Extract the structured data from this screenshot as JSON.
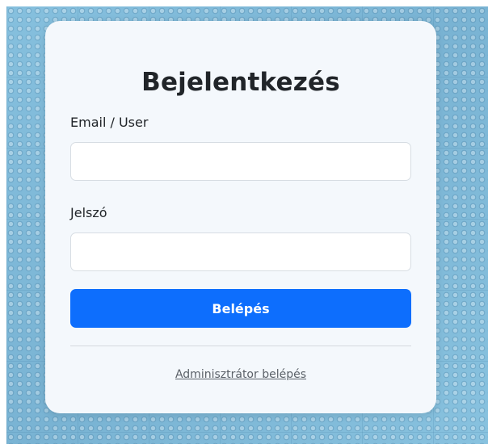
{
  "login": {
    "title": "Bejelentkezés",
    "email_label": "Email / User",
    "email_value": "",
    "password_label": "Jelszó",
    "password_value": "",
    "submit_label": "Belépés",
    "admin_link_label": "Adminisztrátor belépés"
  },
  "colors": {
    "primary_button": "#0d6efd",
    "card_background": "#f4f8fc",
    "page_background": "#7fb9d9"
  }
}
